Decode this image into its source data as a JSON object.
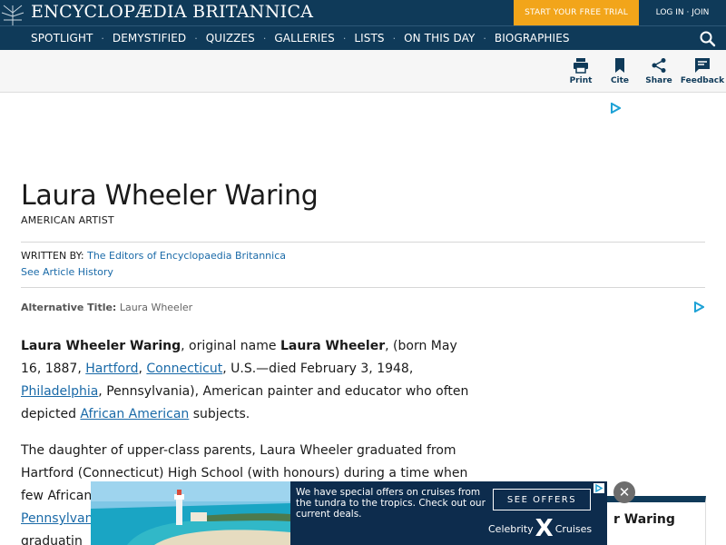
{
  "header": {
    "logo_text": "ENCYCLOPÆDIA BRITANNICA",
    "trial_label": "START YOUR FREE TRIAL",
    "login_label": "LOG IN · JOIN",
    "bg_color": "#0f3a59",
    "trial_color": "#f2a51a"
  },
  "nav": {
    "items": [
      "SPOTLIGHT",
      "DEMYSTIFIED",
      "QUIZZES",
      "GALLERIES",
      "LISTS",
      "ON THIS DAY",
      "BIOGRAPHIES"
    ],
    "separator": "·",
    "search_icon": "search-icon"
  },
  "tools": {
    "print": {
      "label": "Print",
      "icon": "printer-icon"
    },
    "cite": {
      "label": "Cite",
      "icon": "bookmark-icon"
    },
    "share": {
      "label": "Share",
      "icon": "share-icon"
    },
    "feedback": {
      "label": "Feedback",
      "icon": "feedback-icon"
    }
  },
  "article": {
    "title": "Laura Wheeler Waring",
    "subtitle": "AMERICAN ARTIST",
    "written_by_label": "WRITTEN BY:",
    "written_by": "The Editors of Encyclopaedia Britannica",
    "history_link": "See Article History",
    "alt_title_label": "Alternative Title:",
    "alt_title": "Laura Wheeler",
    "para1": {
      "name": "Laura Wheeler Waring",
      "t1": ", original name ",
      "orig": "Laura Wheeler",
      "t2": ", (born May 16, 1887, ",
      "link1": "Hartford",
      "t3": ", ",
      "link2": "Connecticut",
      "t4": ", U.S.—died February 3, 1948, ",
      "link3": "Philadelphia",
      "t5": ", Pennsylvania), American painter and educator who often depicted ",
      "link4": "African American",
      "t6": " subjects."
    },
    "para2": {
      "line1": "The daughter of upper-class parents, Laura Wheeler graduated from",
      "line2": "Hartford (Connecticut) High School (with honours) during a time when",
      "line3": "few African",
      "line4_link": "Pennsylvan",
      "line5": "graduatin"
    }
  },
  "ad": {
    "text": "We have special offers on cruises from the tundra to the tropics. Check out our current deals.",
    "button": "SEE OFFERS",
    "brand_left": "Celebrity",
    "brand_x": "X",
    "brand_right": "Cruises",
    "close": "✕"
  },
  "side_card": {
    "title_fragment": "r Waring"
  }
}
